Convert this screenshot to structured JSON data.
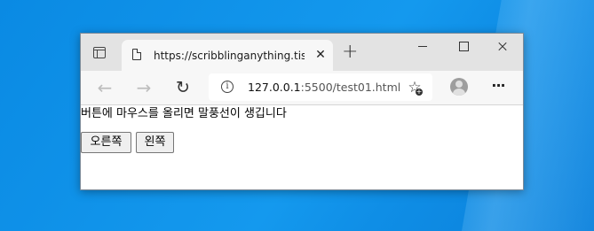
{
  "tab": {
    "title": "https://scribblinganything.tistory",
    "close_glyph": "✕"
  },
  "titlebar": {
    "new_tab_glyph": "+"
  },
  "toolbar": {
    "back_glyph": "←",
    "forward_glyph": "→",
    "refresh_glyph": "↻",
    "info_glyph": "i",
    "url_host": "127.0.0.1",
    "url_rest": ":5500/test01.html",
    "favorites_glyph": "☆",
    "favorites_plus": "+",
    "more_glyph": "···"
  },
  "page": {
    "text": "버튼에 마우스를 올리면 말풍선이 생깁니다",
    "button_right": "오른쪽",
    "button_left": "왼쪽"
  }
}
